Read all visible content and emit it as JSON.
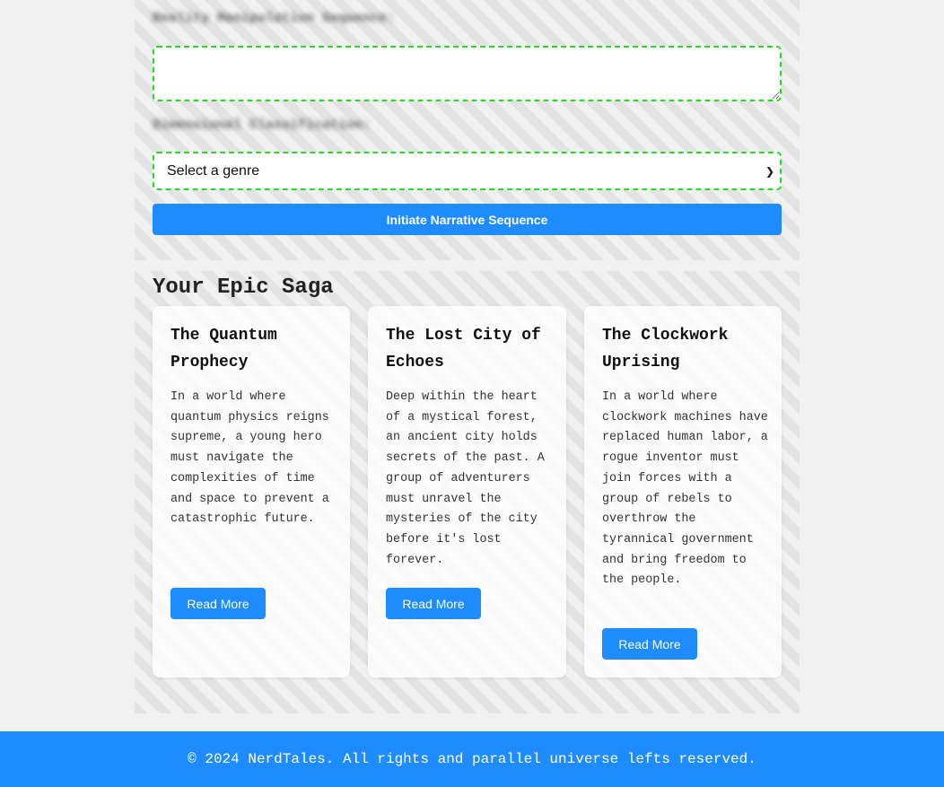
{
  "form": {
    "sequence_label": "Reality Manipulation Sequence:",
    "sequence_value": "",
    "classification_label": "Dimensional Classification:",
    "genre_selected": "Select a genre",
    "submit_label": "Initiate Narrative Sequence"
  },
  "saga": {
    "title": "Your Epic Saga",
    "stories": [
      {
        "title": "The Quantum Prophecy",
        "summary": "In a world where quantum physics reigns supreme, a young hero must navigate the complexities of time and space to prevent a catastrophic future.",
        "button": "Read More"
      },
      {
        "title": "The Lost City of Echoes",
        "summary": "Deep within the heart of a mystical forest, an ancient city holds secrets of the past. A group of adventurers must unravel the mysteries of the city before it's lost forever.",
        "button": "Read More"
      },
      {
        "title": "The Clockwork Uprising",
        "summary": "In a world where clockwork machines have replaced human labor, a rogue inventor must join forces with a group of rebels to overthrow the tyrannical government and bring freedom to the people.",
        "button": "Read More"
      }
    ]
  },
  "footer": {
    "text": "© 2024 NerdTales. All rights and parallel universe lefts reserved."
  },
  "colors": {
    "accent": "#1e8cff",
    "dashed_border": "#22dd22",
    "background": "#f1f1f1"
  }
}
